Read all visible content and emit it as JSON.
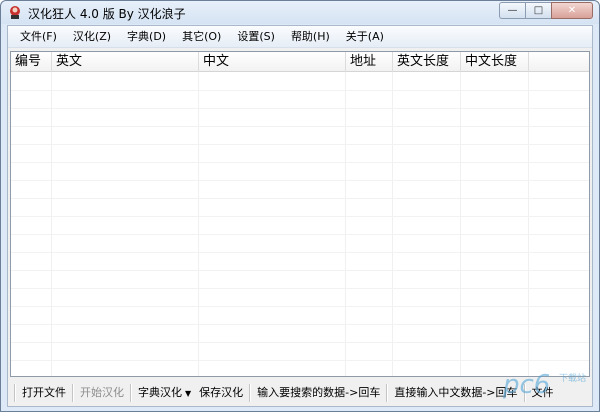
{
  "window": {
    "title": "汉化狂人 4.0 版 By 汉化浪子",
    "controls": {
      "minimize": "—",
      "maximize": "□",
      "close": "✕"
    }
  },
  "menu": {
    "items": [
      "文件(F)",
      "汉化(Z)",
      "字典(D)",
      "其它(O)",
      "设置(S)",
      "帮助(H)",
      "关于(A)"
    ]
  },
  "list": {
    "columns": [
      "编号",
      "英文",
      "中文",
      "地址",
      "英文长度",
      "中文长度"
    ],
    "rows": []
  },
  "toolbar": {
    "open_file": "打开文件",
    "start_translate": "开始汉化",
    "dict_translate": "字典汉化",
    "save_translate": "保存汉化",
    "search_hint": "输入要搜索的数据->回车",
    "direct_input_hint": "直接输入中文数据->回车",
    "trailing_partial": "文件"
  },
  "watermark": {
    "text": "PC6下载站"
  },
  "colors": {
    "title_bg": "#dde9f6",
    "close_btn": "#d8a198",
    "watermark": "#55a6d6"
  }
}
